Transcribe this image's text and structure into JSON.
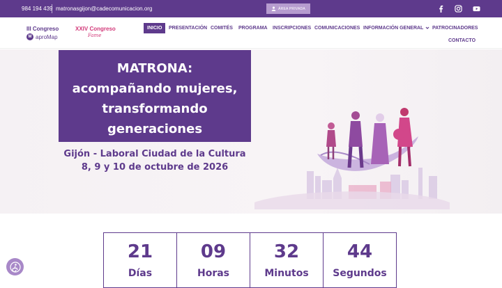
{
  "topbar": {
    "phone": "984 194 439",
    "email": "matronasgijon@cadecomunicacion.org",
    "private_area": "ÁREA PRIVADA",
    "social": [
      "facebook-icon",
      "instagram-icon",
      "youtube-icon"
    ]
  },
  "logos": {
    "logo1_title": "III Congreso",
    "logo1_brand": "aproMap",
    "logo2_title": "XXIV Congreso",
    "logo2_sub": "Fame"
  },
  "nav": {
    "items": [
      {
        "label": "INICIO",
        "active": true
      },
      {
        "label": "PRESENTACIÓN"
      },
      {
        "label": "COMITÉS"
      },
      {
        "label": "PROGRAMA"
      },
      {
        "label": "INSCRIPCIONES"
      },
      {
        "label": "COMUNICACIONES"
      },
      {
        "label": "INFORMACIÓN GENERAL",
        "dropdown": true
      },
      {
        "label": "PATROCINADORES"
      },
      {
        "label": "CONTACTO"
      }
    ]
  },
  "hero": {
    "title_lines": [
      "MATRONA:",
      "acompañando mujeres,",
      "transformando",
      "generaciones"
    ],
    "location": "Gijón - Laboral Ciudad de la Cultura",
    "dates": "8, 9 y 10 de octubre de 2026"
  },
  "countdown": [
    {
      "value": "21",
      "label": "Días"
    },
    {
      "value": "09",
      "label": "Horas"
    },
    {
      "value": "32",
      "label": "Minutos"
    },
    {
      "value": "44",
      "label": "Segundos"
    }
  ],
  "colors": {
    "primary": "#5e3a8c",
    "accent": "#d23a7a",
    "light_purple": "#b69ccf"
  }
}
